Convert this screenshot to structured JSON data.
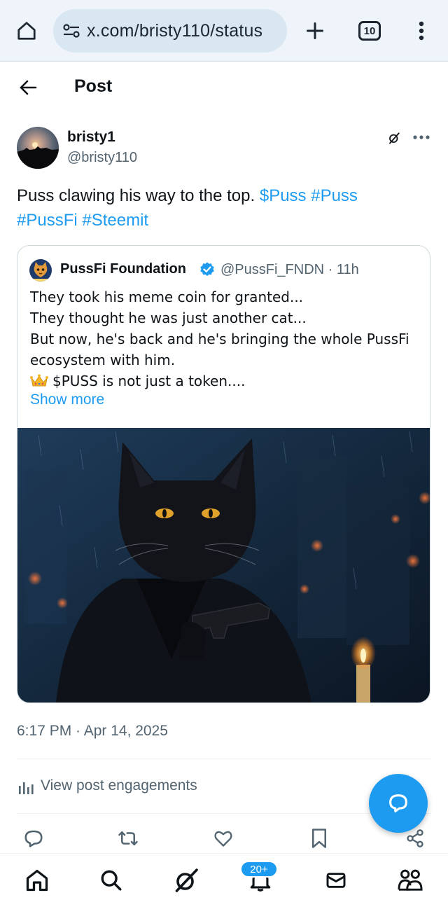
{
  "browser": {
    "url": "x.com/bristy110/status",
    "tab_count": "10"
  },
  "header": {
    "title": "Post"
  },
  "post": {
    "author_name": "bristy1",
    "author_handle": "@bristy110",
    "text_plain": "Puss clawing his way to the top.",
    "hashtags": [
      "$Puss",
      "#Puss",
      "#PussFi",
      "#Steemit"
    ],
    "timestamp": "6:17 PM · Apr 14, 2025",
    "engagements_label": "View post engagements"
  },
  "quote": {
    "name": "PussFi Foundation",
    "handle_time": "@PussFi_FNDN · 11h",
    "lines": [
      "They took his meme coin for granted...",
      "They thought he was just another cat...",
      "But now, he's back and he's bringing the whole PussFi",
      "ecosystem with him.",
      "$PUSS is not just a token...."
    ],
    "show_more": "Show more"
  },
  "nav": {
    "notifications_badge": "20+"
  },
  "colors": {
    "accent": "#1d9bf0",
    "text": "#0f1419",
    "muted": "#536471"
  }
}
